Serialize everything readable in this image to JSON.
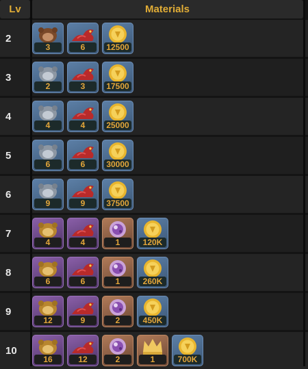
{
  "header": {
    "lv": "Lv",
    "materials": "Materials"
  },
  "rows": [
    {
      "lv": "2",
      "items": [
        {
          "icon": "brown-monkey-icon",
          "bg": "blue",
          "count": "3"
        },
        {
          "icon": "red-dragon-icon",
          "bg": "blue",
          "count": "6"
        },
        {
          "icon": "gold-coin-icon",
          "bg": "blue",
          "count": "12500"
        }
      ]
    },
    {
      "lv": "3",
      "items": [
        {
          "icon": "gray-monkey-icon",
          "bg": "blue",
          "count": "2"
        },
        {
          "icon": "red-dragon-icon",
          "bg": "blue",
          "count": "3"
        },
        {
          "icon": "gold-coin-icon",
          "bg": "blue",
          "count": "17500"
        }
      ]
    },
    {
      "lv": "4",
      "items": [
        {
          "icon": "gray-monkey-icon",
          "bg": "blue",
          "count": "4"
        },
        {
          "icon": "red-dragon-icon",
          "bg": "blue",
          "count": "4"
        },
        {
          "icon": "gold-coin-icon",
          "bg": "blue",
          "count": "25000"
        }
      ]
    },
    {
      "lv": "5",
      "items": [
        {
          "icon": "gray-monkey-icon",
          "bg": "blue",
          "count": "6"
        },
        {
          "icon": "red-dragon-icon",
          "bg": "blue",
          "count": "6"
        },
        {
          "icon": "gold-coin-icon",
          "bg": "blue",
          "count": "30000"
        }
      ]
    },
    {
      "lv": "6",
      "items": [
        {
          "icon": "gray-monkey-icon",
          "bg": "blue",
          "count": "9"
        },
        {
          "icon": "red-dragon-icon",
          "bg": "blue",
          "count": "9"
        },
        {
          "icon": "gold-coin-icon",
          "bg": "blue",
          "count": "37500"
        }
      ]
    },
    {
      "lv": "7",
      "items": [
        {
          "icon": "gold-monkey-icon",
          "bg": "purple",
          "count": "4"
        },
        {
          "icon": "red-dragon-icon",
          "bg": "purple",
          "count": "4"
        },
        {
          "icon": "purple-orb-icon",
          "bg": "orange",
          "count": "1"
        },
        {
          "icon": "gold-coin-icon",
          "bg": "blue",
          "count": "120K"
        }
      ]
    },
    {
      "lv": "8",
      "items": [
        {
          "icon": "gold-monkey-icon",
          "bg": "purple",
          "count": "6"
        },
        {
          "icon": "red-dragon-icon",
          "bg": "purple",
          "count": "6"
        },
        {
          "icon": "purple-orb-icon",
          "bg": "orange",
          "count": "1"
        },
        {
          "icon": "gold-coin-icon",
          "bg": "blue",
          "count": "260K"
        }
      ]
    },
    {
      "lv": "9",
      "items": [
        {
          "icon": "gold-monkey-icon",
          "bg": "purple",
          "count": "12"
        },
        {
          "icon": "red-dragon-icon",
          "bg": "purple",
          "count": "9"
        },
        {
          "icon": "purple-orb-icon",
          "bg": "orange",
          "count": "2"
        },
        {
          "icon": "gold-coin-icon",
          "bg": "blue",
          "count": "450K"
        }
      ]
    },
    {
      "lv": "10",
      "items": [
        {
          "icon": "gold-monkey-icon",
          "bg": "purple",
          "count": "16"
        },
        {
          "icon": "red-dragon-icon",
          "bg": "purple",
          "count": "12"
        },
        {
          "icon": "purple-orb-icon",
          "bg": "orange",
          "count": "2"
        },
        {
          "icon": "gold-crown-icon",
          "bg": "orange",
          "count": "1"
        },
        {
          "icon": "gold-coin-icon",
          "bg": "blue",
          "count": "700K"
        }
      ]
    }
  ],
  "colors": {
    "accent": "#e0ac36",
    "count_text": "#e3a63a"
  }
}
